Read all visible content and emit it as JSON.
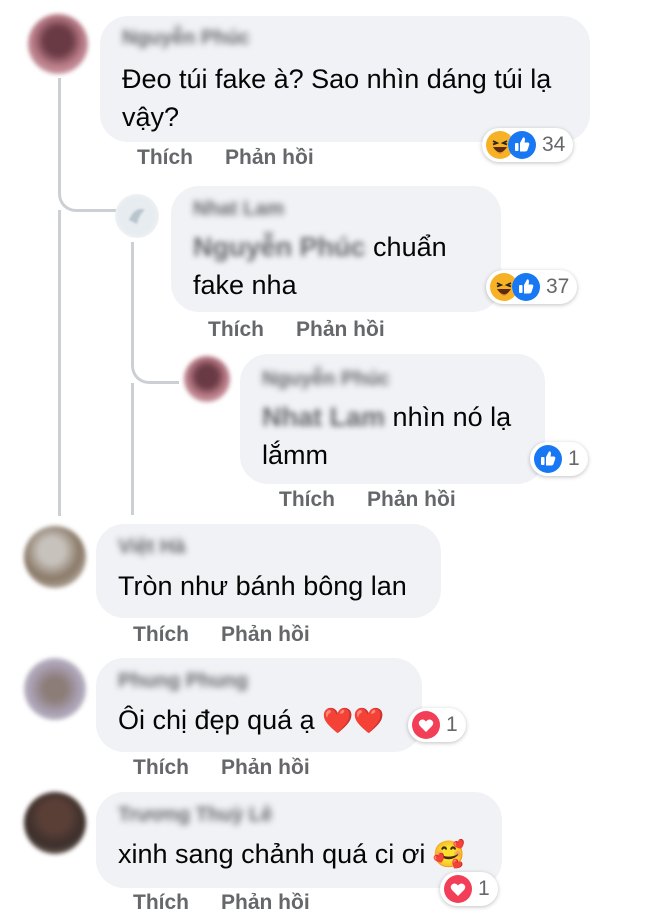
{
  "actions": {
    "like": "Thích",
    "reply": "Phản hồi"
  },
  "colors": {
    "bubble": "#f0f2f5",
    "secondary_text": "#65676b",
    "like_blue": "#1877f2",
    "love_red": "#f33e58",
    "haha_yellow": "#f7b125"
  },
  "comments": [
    {
      "author": "Nguyễn Phúc",
      "text": "Đeo túi fake à? Sao nhìn dáng túi lạ vậy?",
      "text_line1": "Đeo túi fake à? Sao nhìn dáng túi lạ",
      "text_line2": "vậy?",
      "reactions": [
        "haha-icon",
        "like-icon"
      ],
      "reaction_count": "34",
      "replies": [
        {
          "author": "Nhat Lam",
          "mention": "Nguyễn Phúc",
          "text_line1": "chuẩn",
          "text_line2": "fake nha",
          "reactions": [
            "haha-icon",
            "like-icon"
          ],
          "reaction_count": "37"
        },
        {
          "author": "Nguyễn Phúc",
          "mention": "Nhat Lam",
          "text_line1": "nhìn nó lạ",
          "text_line2": "lắmm",
          "reactions": [
            "like-icon"
          ],
          "reaction_count": "1"
        }
      ]
    },
    {
      "author": "Việt Hà",
      "text": "Tròn như bánh bông lan"
    },
    {
      "author": "Phung Phung",
      "text": "Ôi chị đẹp quá ạ",
      "emoji": "❤️❤️",
      "reactions": [
        "love-icon"
      ],
      "reaction_count": "1"
    },
    {
      "author": "Trương Thuỳ Lê",
      "text": "xinh sang chảnh quá ci ơi",
      "emoji": "🥰",
      "reactions": [
        "love-icon"
      ],
      "reaction_count": "1"
    }
  ]
}
